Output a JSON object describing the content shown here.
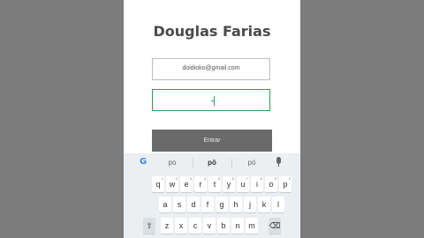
{
  "login": {
    "title": "Douglas Farias",
    "email_value": "doidioko@gmail.com",
    "password_value": "",
    "enter_label": "Entrar"
  },
  "keyboard": {
    "suggestions": [
      "po",
      "pô",
      "pó"
    ],
    "row1": [
      {
        "k": "q",
        "n": "1"
      },
      {
        "k": "w",
        "n": "2"
      },
      {
        "k": "e",
        "n": "3"
      },
      {
        "k": "r",
        "n": "4"
      },
      {
        "k": "t",
        "n": "5"
      },
      {
        "k": "y",
        "n": "6"
      },
      {
        "k": "u",
        "n": "7"
      },
      {
        "k": "i",
        "n": "8"
      },
      {
        "k": "o",
        "n": "9"
      },
      {
        "k": "p",
        "n": "0"
      }
    ],
    "row2": [
      "a",
      "s",
      "d",
      "f",
      "g",
      "h",
      "j",
      "k",
      "l"
    ],
    "row3": [
      "z",
      "x",
      "c",
      "v",
      "b",
      "n",
      "m"
    ],
    "shift_symbol": "⇧",
    "backspace_symbol": "⌫",
    "google_letter": "G"
  }
}
